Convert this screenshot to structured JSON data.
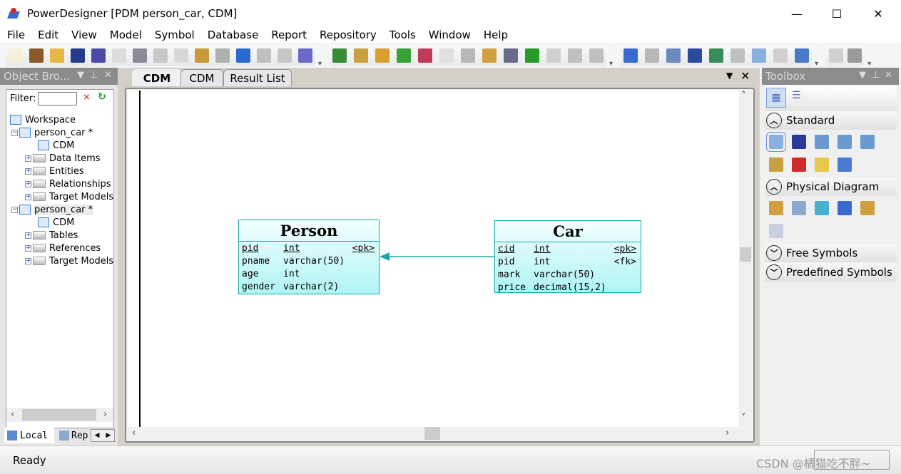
{
  "window": {
    "title": "PowerDesigner [PDM person_car, CDM]",
    "minimize": "—",
    "maximize": "☐",
    "close": "✕"
  },
  "menu": [
    "File",
    "Edit",
    "View",
    "Model",
    "Symbol",
    "Database",
    "Report",
    "Repository",
    "Tools",
    "Window",
    "Help"
  ],
  "toolbar": {
    "groups": [
      [
        "new-icon",
        "open-project-icon",
        "open-icon",
        "save-icon",
        "save-all-icon",
        "print-preview-icon",
        "print-icon",
        "cut-icon",
        "copy-icon",
        "paste-icon",
        "delete-icon",
        "undo-icon",
        "redo-icon",
        "properties-icon",
        "help-icon"
      ],
      [
        "new-model-icon",
        "paste-shortcut-icon",
        "find-icon",
        "refresh-icon",
        "check-model-icon",
        "shadow-icon",
        "align-icon",
        "brush-icon",
        "fill-icon",
        "font-icon",
        "text-icon",
        "back-icon",
        "forward-icon"
      ],
      [
        "diagram-icon",
        "list-icon",
        "page-icon",
        "split-icon",
        "network-icon",
        "grid-icon",
        "zoom-window-icon",
        "comment-icon",
        "view-icon"
      ],
      [
        "preview-icon",
        "printer-icon"
      ]
    ],
    "colors": {
      "new-icon": "#f5f0d8",
      "open-project-icon": "#8a5a2a",
      "open-icon": "#e6b84a",
      "save-icon": "#243a8c",
      "save-all-icon": "#4a4aa8",
      "print-preview-icon": "#dcdcdc",
      "print-icon": "#8a8a9a",
      "cut-icon": "#c8c8c8",
      "copy-icon": "#d8d8d8",
      "paste-icon": "#c89a3a",
      "delete-icon": "#b0b0b0",
      "undo-icon": "#2a6ad0",
      "redo-icon": "#c0c0c0",
      "properties-icon": "#c8c8c8",
      "help-icon": "#6a6ac8",
      "new-model-icon": "#3a8a3a",
      "paste-shortcut-icon": "#c8a040",
      "find-icon": "#d8a030",
      "refresh-icon": "#3aa03a",
      "check-model-icon": "#c03a5a",
      "shadow-icon": "#e0e0e0",
      "align-icon": "#b8b8b8",
      "brush-icon": "#d0a040",
      "fill-icon": "#6a6a8a",
      "font-icon": "#2a9a2a",
      "text-icon": "#d0d0d0",
      "back-icon": "#c0c0c0",
      "forward-icon": "#c0c0c0",
      "diagram-icon": "#3a6ad0",
      "list-icon": "#b8b8b8",
      "page-icon": "#6a8ac0",
      "split-icon": "#2a4a9a",
      "network-icon": "#3a8a5a",
      "grid-icon": "#c0c0c0",
      "zoom-window-icon": "#8ab0e0",
      "comment-icon": "#d0d0d0",
      "view-icon": "#4a7ac8",
      "preview-icon": "#d0d0d0",
      "printer-icon": "#9a9a9a"
    }
  },
  "object_browser": {
    "title": "Object Bro...",
    "filter_label": "Filter:",
    "filter_value": "",
    "tree": [
      {
        "label": "Workspace",
        "level": 0
      },
      {
        "label": "person_car *",
        "level": 1,
        "expanded": true
      },
      {
        "label": "CDM",
        "level": 2
      },
      {
        "label": "Data Items",
        "level": 2,
        "folder": true
      },
      {
        "label": "Entities",
        "level": 2,
        "folder": true
      },
      {
        "label": "Relationships",
        "level": 2,
        "folder": true
      },
      {
        "label": "Target Models",
        "level": 2,
        "folder": true
      },
      {
        "label": "person_car *",
        "level": 1,
        "expanded": true,
        "selected": true
      },
      {
        "label": "CDM",
        "level": 2
      },
      {
        "label": "Tables",
        "level": 2,
        "folder": true
      },
      {
        "label": "References",
        "level": 2,
        "folder": true
      },
      {
        "label": "Target Models",
        "level": 2,
        "folder": true
      }
    ],
    "bottom_tabs": [
      "Local",
      "Rep"
    ]
  },
  "tabs": [
    {
      "label": "CDM",
      "active": true
    },
    {
      "label": "CDM"
    },
    {
      "label": "Result List"
    }
  ],
  "diagram": {
    "accent": "#16a8a8",
    "entities": [
      {
        "name": "Person",
        "attributes": [
          {
            "name": "pid",
            "type": "int",
            "key": "<pk>",
            "underline": true
          },
          {
            "name": "pname",
            "type": "varchar(50)",
            "key": ""
          },
          {
            "name": "age",
            "type": "int",
            "key": ""
          },
          {
            "name": "gender",
            "type": "varchar(2)",
            "key": ""
          }
        ]
      },
      {
        "name": "Car",
        "attributes": [
          {
            "name": "cid",
            "type": "int",
            "key": "<pk>",
            "underline": true
          },
          {
            "name": "pid",
            "type": "int",
            "key": "<fk>"
          },
          {
            "name": "mark",
            "type": "varchar(50)",
            "key": ""
          },
          {
            "name": "price",
            "type": "decimal(15,2)",
            "key": ""
          }
        ]
      }
    ],
    "reference": {
      "from": "Car",
      "to": "Person"
    }
  },
  "toolbox": {
    "title": "Toolbox",
    "sections": [
      {
        "label": "Standard",
        "expanded": true,
        "tools": [
          "pointer-icon",
          "grabber-icon",
          "zoom-in-icon",
          "zoom-out-icon",
          "zoom-fit-icon",
          "properties-tool-icon",
          "delete-tool-icon",
          "note-icon",
          "link-icon"
        ]
      },
      {
        "label": "Physical Diagram",
        "expanded": true,
        "tools": [
          "package-icon",
          "table-icon",
          "view-table-icon",
          "reference-icon",
          "procedure-icon",
          "file-icon"
        ]
      },
      {
        "label": "Free Symbols",
        "expanded": false
      },
      {
        "label": "Predefined Symbols",
        "expanded": false
      }
    ]
  },
  "status": {
    "text": "Ready",
    "watermark": "CSDN @橘猫吃不胖~"
  }
}
